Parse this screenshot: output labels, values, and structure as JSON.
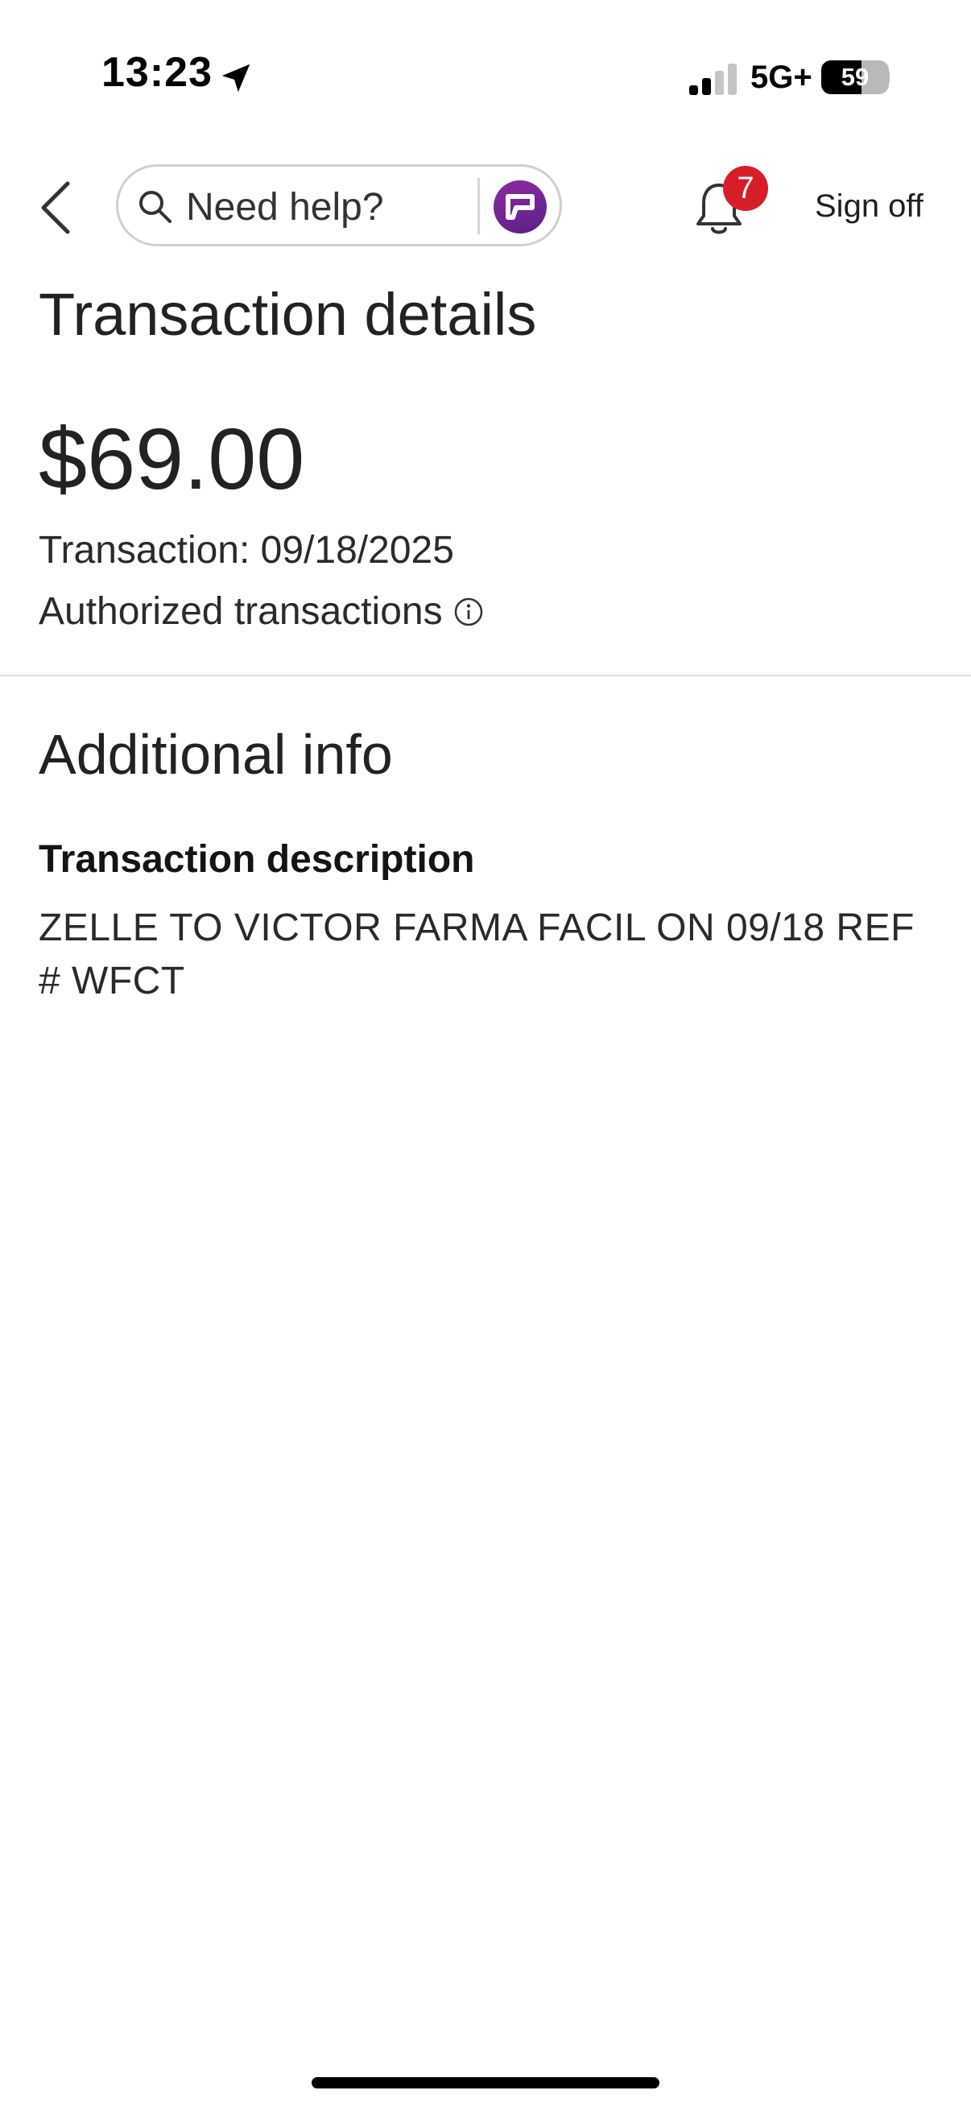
{
  "status_bar": {
    "time": "13:23",
    "network": "5G+",
    "battery_level": "59",
    "battery_fraction": 0.59,
    "signal_bars_active": 2,
    "signal_bars_total": 4,
    "icons": [
      "location-arrow-icon",
      "signal-icon",
      "battery-icon"
    ]
  },
  "header": {
    "back_icon": "chevron-left-icon",
    "search": {
      "placeholder": "Need help?",
      "icon": "search-icon"
    },
    "assistant_icon": "fargo-assistant-icon",
    "notifications": {
      "icon": "bell-icon",
      "count": "7"
    },
    "sign_off_label": "Sign off"
  },
  "main": {
    "title": "Transaction details",
    "amount": "$69.00",
    "transaction_date": "Transaction: 09/18/2025",
    "status_label": "Authorized transactions",
    "status_icon": "info-icon"
  },
  "additional_info": {
    "title": "Additional info",
    "description_label": "Transaction description",
    "description_value": "ZELLE TO VICTOR FARMA FACIL ON 09/18 REF # WFCT"
  },
  "colors": {
    "badge": "#d71e28",
    "assistant_purple": "#6b2391",
    "text": "#1f1f1f",
    "divider": "#dcdcdc"
  }
}
